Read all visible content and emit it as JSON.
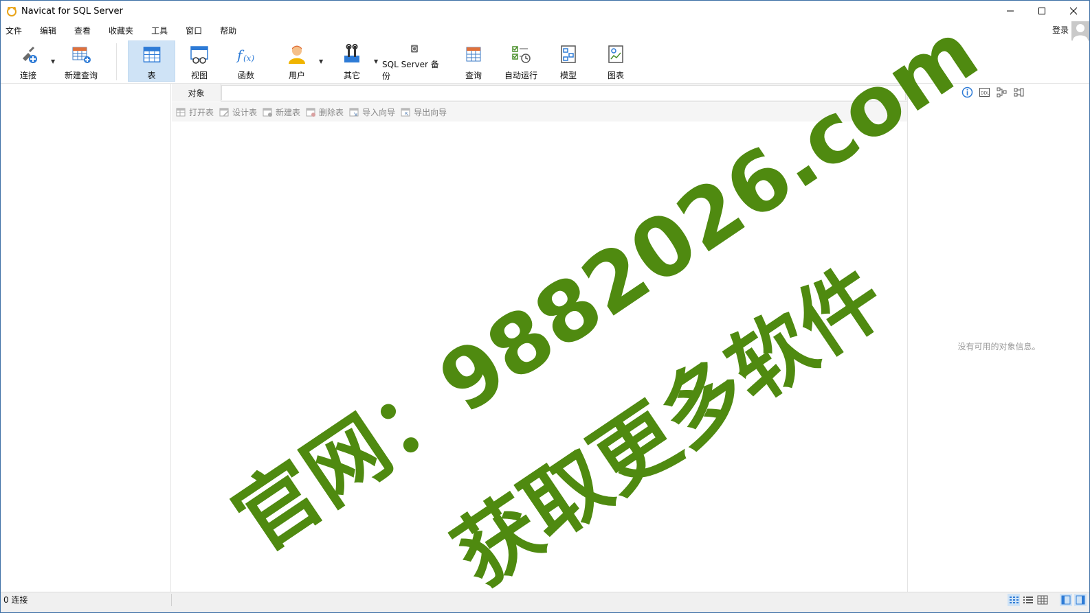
{
  "window": {
    "title": "Navicat for SQL Server"
  },
  "menu": [
    "文件",
    "编辑",
    "查看",
    "收藏夹",
    "工具",
    "窗口",
    "帮助"
  ],
  "account": {
    "login_label": "登录"
  },
  "toolbar": {
    "connect": "连接",
    "new_query": "新建查询",
    "table": "表",
    "view": "视图",
    "function": "函数",
    "user": "用户",
    "other": "其它",
    "backup": "SQL Server 备份",
    "query": "查询",
    "automation": "自动运行",
    "model": "模型",
    "chart": "图表"
  },
  "tabs": {
    "objects": "对象"
  },
  "object_toolbar": {
    "open_table": "打开表",
    "design_table": "设计表",
    "new_table": "新建表",
    "delete_table": "删除表",
    "import_wizard": "导入向导",
    "export_wizard": "导出向导"
  },
  "info_panel": {
    "empty_message": "没有可用的对象信息。"
  },
  "status": {
    "connections": "0 连接"
  },
  "watermark": {
    "line1": "官网：9882026.com",
    "line2": "获取更多软件"
  },
  "colors": {
    "active_tool_bg": "#cfe3f6",
    "accent_blue": "#2e7bd6",
    "watermark": "#4f8a10"
  }
}
